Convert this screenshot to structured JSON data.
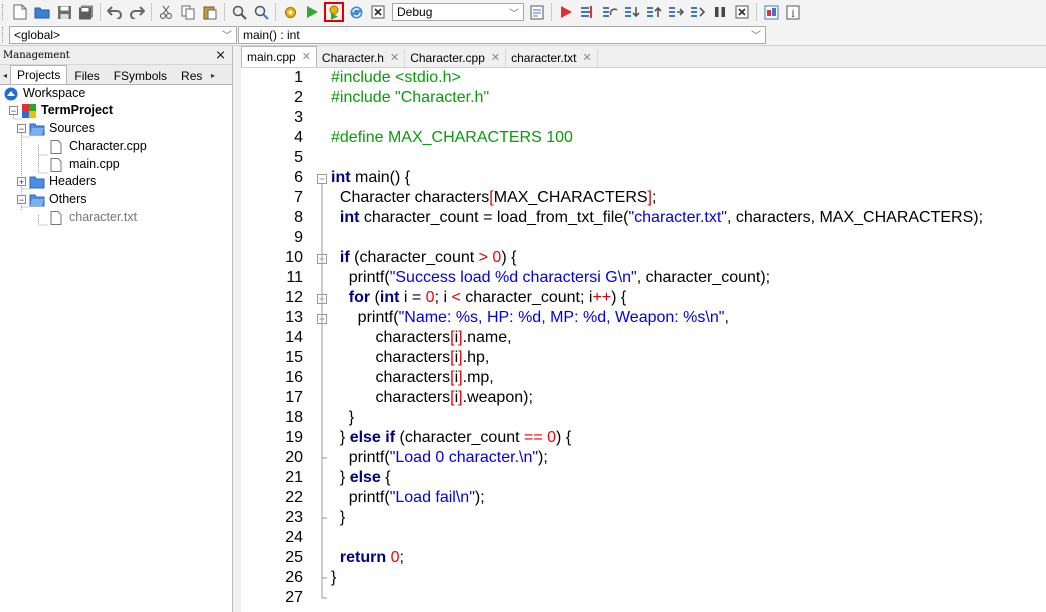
{
  "toolbar": {
    "build_config": "Debug"
  },
  "scope": {
    "left": "<global>",
    "right": "main() : int"
  },
  "management": {
    "title": "Management",
    "close": "×",
    "tabs": [
      "Projects",
      "Files",
      "FSymbols",
      "Res"
    ],
    "active_tab": 0,
    "tree": {
      "workspace": "Workspace",
      "project": "TermProject",
      "sources": "Sources",
      "source_files": [
        "Character.cpp",
        "main.cpp"
      ],
      "headers": "Headers",
      "others": "Others",
      "other_files": [
        "character.txt"
      ]
    }
  },
  "editor": {
    "tabs": [
      "main.cpp",
      "Character.h",
      "Character.cpp",
      "character.txt"
    ],
    "active_tab": 0,
    "line_numbers": [
      "1",
      "2",
      "3",
      "4",
      "5",
      "6",
      "7",
      "8",
      "9",
      "10",
      "11",
      "12",
      "13",
      "14",
      "15",
      "16",
      "17",
      "18",
      "19",
      "20",
      "21",
      "22",
      "23",
      "24",
      "25",
      "26",
      "27"
    ],
    "lines": [
      [
        [
          "pp",
          "#include <stdio.h>"
        ]
      ],
      [
        [
          "pp",
          "#include \"Character.h\""
        ]
      ],
      [],
      [
        [
          "pp",
          "#define MAX_CHARACTERS 100"
        ]
      ],
      [],
      [
        [
          "kw",
          "int"
        ],
        [
          "plain",
          " main() {"
        ]
      ],
      [
        [
          "plain",
          "  Character characters"
        ],
        [
          "op",
          "["
        ],
        [
          "plain",
          "MAX_CHARACTERS"
        ],
        [
          "op",
          "]"
        ],
        [
          "plain",
          ";"
        ]
      ],
      [
        [
          "plain",
          "  "
        ],
        [
          "kw",
          "int"
        ],
        [
          "plain",
          " character_count = load_from_txt_file("
        ],
        [
          "str",
          "\"character.txt\""
        ],
        [
          "plain",
          ", characters, MAX_CHARACTERS);"
        ]
      ],
      [],
      [
        [
          "plain",
          "  "
        ],
        [
          "kw",
          "if"
        ],
        [
          "plain",
          " (character_count "
        ],
        [
          "op",
          ">"
        ],
        [
          "plain",
          " "
        ],
        [
          "num",
          "0"
        ],
        [
          "plain",
          ") {"
        ]
      ],
      [
        [
          "plain",
          "    printf("
        ],
        [
          "str",
          "\"Success load %d charactersi G\\n\""
        ],
        [
          "plain",
          ", character_count);"
        ]
      ],
      [
        [
          "plain",
          "    "
        ],
        [
          "kw",
          "for"
        ],
        [
          "plain",
          " ("
        ],
        [
          "kw",
          "int"
        ],
        [
          "plain",
          " i = "
        ],
        [
          "num",
          "0"
        ],
        [
          "plain",
          "; i "
        ],
        [
          "op",
          "<"
        ],
        [
          "plain",
          " character_count; i"
        ],
        [
          "op",
          "++"
        ],
        [
          "plain",
          ") {"
        ]
      ],
      [
        [
          "plain",
          "      printf("
        ],
        [
          "str",
          "\"Name: %s, HP: %d, MP: %d, Weapon: %s\\n\""
        ],
        [
          "plain",
          ","
        ]
      ],
      [
        [
          "plain",
          "          characters"
        ],
        [
          "op",
          "["
        ],
        [
          "plain",
          "i"
        ],
        [
          "op",
          "]"
        ],
        [
          "plain",
          ".name,"
        ]
      ],
      [
        [
          "plain",
          "          characters"
        ],
        [
          "op",
          "["
        ],
        [
          "plain",
          "i"
        ],
        [
          "op",
          "]"
        ],
        [
          "plain",
          ".hp,"
        ]
      ],
      [
        [
          "plain",
          "          characters"
        ],
        [
          "op",
          "["
        ],
        [
          "plain",
          "i"
        ],
        [
          "op",
          "]"
        ],
        [
          "plain",
          ".mp,"
        ]
      ],
      [
        [
          "plain",
          "          characters"
        ],
        [
          "op",
          "["
        ],
        [
          "plain",
          "i"
        ],
        [
          "op",
          "]"
        ],
        [
          "plain",
          ".weapon);"
        ]
      ],
      [
        [
          "plain",
          "    }"
        ]
      ],
      [
        [
          "plain",
          "  } "
        ],
        [
          "kw",
          "else if"
        ],
        [
          "plain",
          " (character_count "
        ],
        [
          "op",
          "=="
        ],
        [
          "plain",
          " "
        ],
        [
          "num",
          "0"
        ],
        [
          "plain",
          ") {"
        ]
      ],
      [
        [
          "plain",
          "    printf("
        ],
        [
          "str",
          "\"Load 0 character.\\n\""
        ],
        [
          "plain",
          ");"
        ]
      ],
      [
        [
          "plain",
          "  } "
        ],
        [
          "kw",
          "else"
        ],
        [
          "plain",
          " {"
        ]
      ],
      [
        [
          "plain",
          "    printf("
        ],
        [
          "str",
          "\"Load fail\\n\""
        ],
        [
          "plain",
          ");"
        ]
      ],
      [
        [
          "plain",
          "  }"
        ]
      ],
      [],
      [
        [
          "plain",
          "  "
        ],
        [
          "kw",
          "return"
        ],
        [
          "plain",
          " "
        ],
        [
          "num",
          "0"
        ],
        [
          "plain",
          ";"
        ]
      ],
      [
        [
          "plain",
          "}"
        ]
      ],
      []
    ]
  },
  "colors": {
    "keyword": "#000080",
    "preprocessor": "#0a9a0a",
    "string": "#0000e0",
    "number": "#ff0000",
    "highlight_box": "#e00000"
  }
}
